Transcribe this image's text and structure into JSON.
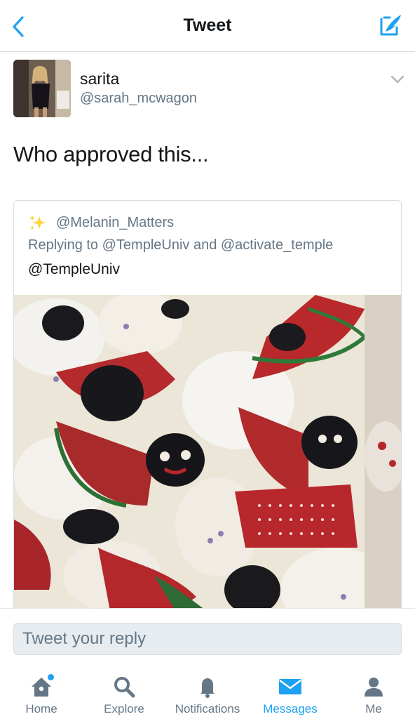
{
  "header": {
    "title": "Tweet",
    "back_icon": "chevron-left-icon",
    "compose_icon": "compose-tweet-icon",
    "accent": "#1da1f2"
  },
  "author": {
    "name": "sarita",
    "handle": "@sarah_mcwagon",
    "menu_icon": "chevron-down-icon"
  },
  "tweet": {
    "text": "Who approved this..."
  },
  "quoted": {
    "emoji_icon": "sparkles-icon",
    "handle": "@Melanin_Matters",
    "replying_to": "Replying to @TempleUniv and @activate_temple",
    "text": "@TempleUniv"
  },
  "reply": {
    "placeholder": "Tweet your reply"
  },
  "tabs": [
    {
      "label": "Home",
      "icon": "home-icon",
      "active": false,
      "notification_dot": true
    },
    {
      "label": "Explore",
      "icon": "search-icon",
      "active": false
    },
    {
      "label": "Notifications",
      "icon": "bell-icon",
      "active": false
    },
    {
      "label": "Messages",
      "icon": "envelope-icon",
      "active": true
    },
    {
      "label": "Me",
      "icon": "person-icon",
      "active": false
    }
  ]
}
